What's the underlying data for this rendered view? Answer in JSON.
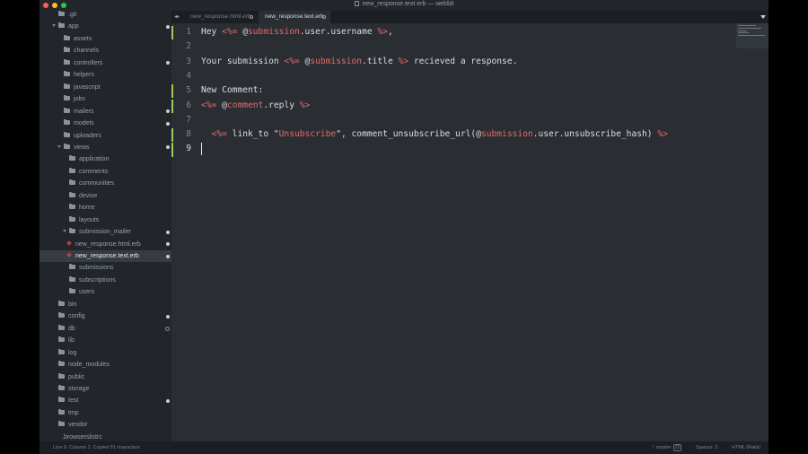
{
  "window": {
    "title": "new_response.text.erb — webbit",
    "traffic_lights": {
      "close": "#ff5f57",
      "minimize": "#febc2e",
      "zoom": "#28c840"
    }
  },
  "sidebar": {
    "items": [
      {
        "label": ".git",
        "kind": "folder",
        "depth": 1,
        "marker": "none"
      },
      {
        "label": "app",
        "kind": "folder-open",
        "depth": 1,
        "marker": "filled"
      },
      {
        "label": "assets",
        "kind": "folder",
        "depth": 2,
        "marker": "none"
      },
      {
        "label": "channels",
        "kind": "folder",
        "depth": 2,
        "marker": "none"
      },
      {
        "label": "controllers",
        "kind": "folder",
        "depth": 2,
        "marker": "filled"
      },
      {
        "label": "helpers",
        "kind": "folder",
        "depth": 2,
        "marker": "none"
      },
      {
        "label": "javascript",
        "kind": "folder",
        "depth": 2,
        "marker": "none"
      },
      {
        "label": "jobs",
        "kind": "folder",
        "depth": 2,
        "marker": "none"
      },
      {
        "label": "mailers",
        "kind": "folder",
        "depth": 2,
        "marker": "filled"
      },
      {
        "label": "models",
        "kind": "folder",
        "depth": 2,
        "marker": "filled"
      },
      {
        "label": "uploaders",
        "kind": "folder",
        "depth": 2,
        "marker": "none"
      },
      {
        "label": "views",
        "kind": "folder-open",
        "depth": 2,
        "marker": "filled"
      },
      {
        "label": "application",
        "kind": "folder",
        "depth": 3,
        "marker": "none"
      },
      {
        "label": "comments",
        "kind": "folder",
        "depth": 3,
        "marker": "none"
      },
      {
        "label": "communities",
        "kind": "folder",
        "depth": 3,
        "marker": "none"
      },
      {
        "label": "devise",
        "kind": "folder",
        "depth": 3,
        "marker": "none"
      },
      {
        "label": "home",
        "kind": "folder",
        "depth": 3,
        "marker": "none"
      },
      {
        "label": "layouts",
        "kind": "folder",
        "depth": 3,
        "marker": "none"
      },
      {
        "label": "submission_mailer",
        "kind": "folder-open",
        "depth": 3,
        "marker": "filled"
      },
      {
        "label": "new_response.html.erb",
        "kind": "file",
        "depth": 4,
        "marker": "filled"
      },
      {
        "label": "new_response.text.erb",
        "kind": "file",
        "depth": 4,
        "marker": "filled",
        "selected": true
      },
      {
        "label": "submissions",
        "kind": "folder",
        "depth": 3,
        "marker": "none"
      },
      {
        "label": "subscriptions",
        "kind": "folder",
        "depth": 3,
        "marker": "none"
      },
      {
        "label": "users",
        "kind": "folder",
        "depth": 3,
        "marker": "none"
      },
      {
        "label": "bin",
        "kind": "folder",
        "depth": 1,
        "marker": "none"
      },
      {
        "label": "config",
        "kind": "folder",
        "depth": 1,
        "marker": "filled"
      },
      {
        "label": "db",
        "kind": "folder",
        "depth": 1,
        "marker": "hollow"
      },
      {
        "label": "lib",
        "kind": "folder",
        "depth": 1,
        "marker": "none"
      },
      {
        "label": "log",
        "kind": "folder",
        "depth": 1,
        "marker": "none"
      },
      {
        "label": "node_modules",
        "kind": "folder",
        "depth": 1,
        "marker": "none"
      },
      {
        "label": "public",
        "kind": "folder",
        "depth": 1,
        "marker": "none"
      },
      {
        "label": "storage",
        "kind": "folder",
        "depth": 1,
        "marker": "none"
      },
      {
        "label": "test",
        "kind": "folder",
        "depth": 1,
        "marker": "filled"
      },
      {
        "label": "tmp",
        "kind": "folder",
        "depth": 1,
        "marker": "none"
      },
      {
        "label": "vendor",
        "kind": "folder",
        "depth": 1,
        "marker": "none"
      },
      {
        "label": ".browserslistrc",
        "kind": "file-plain",
        "depth": 1,
        "marker": "none"
      }
    ]
  },
  "tabs": [
    {
      "label": "new_response.html.erb",
      "active": false
    },
    {
      "label": "new_response.text.erb",
      "active": true
    }
  ],
  "editor": {
    "current_line": 9,
    "modified_lines": [
      1,
      5,
      6,
      8,
      9
    ],
    "lines": [
      {
        "n": "1",
        "parts": [
          [
            "t",
            "Hey "
          ],
          [
            "tag",
            "<%="
          ],
          [
            "t",
            " @"
          ],
          [
            "ivar",
            "submission"
          ],
          [
            "t",
            ".user.username "
          ],
          [
            "tag",
            "%>"
          ],
          [
            "t",
            ","
          ]
        ]
      },
      {
        "n": "2",
        "parts": []
      },
      {
        "n": "3",
        "parts": [
          [
            "t",
            "Your submission "
          ],
          [
            "tag",
            "<%="
          ],
          [
            "t",
            " @"
          ],
          [
            "ivar",
            "submission"
          ],
          [
            "t",
            ".title "
          ],
          [
            "tag",
            "%>"
          ],
          [
            "t",
            " recieved a response."
          ]
        ]
      },
      {
        "n": "4",
        "parts": []
      },
      {
        "n": "5",
        "parts": [
          [
            "t",
            "New Comment:"
          ]
        ]
      },
      {
        "n": "6",
        "parts": [
          [
            "tag",
            "<%="
          ],
          [
            "t",
            " @"
          ],
          [
            "ivar",
            "comment"
          ],
          [
            "t",
            ".reply "
          ],
          [
            "tag",
            "%>"
          ]
        ]
      },
      {
        "n": "7",
        "parts": []
      },
      {
        "n": "8",
        "parts": [
          [
            "t",
            "  "
          ],
          [
            "tag",
            "<%="
          ],
          [
            "t",
            " link_to \""
          ],
          [
            "ivar",
            "Unsubscribe"
          ],
          [
            "t",
            "\", comment_unsubscribe_url(@"
          ],
          [
            "ivar",
            "submission"
          ],
          [
            "t",
            ".user.unsubscribe_hash) "
          ],
          [
            "tag",
            "%>"
          ]
        ]
      },
      {
        "n": "9",
        "parts": []
      }
    ]
  },
  "status": {
    "position": "Line 9, Column 1; Copied 91 characters",
    "branch": "master",
    "branch_count": "22",
    "spaces": "Spaces: 2",
    "syntax": "HTML (Rails)"
  },
  "colors": {
    "erb_tag": "#e26a6a",
    "git_modified": "#a1c95a",
    "editor_bg": "#2a2e33",
    "sidebar_bg": "#22262b"
  }
}
